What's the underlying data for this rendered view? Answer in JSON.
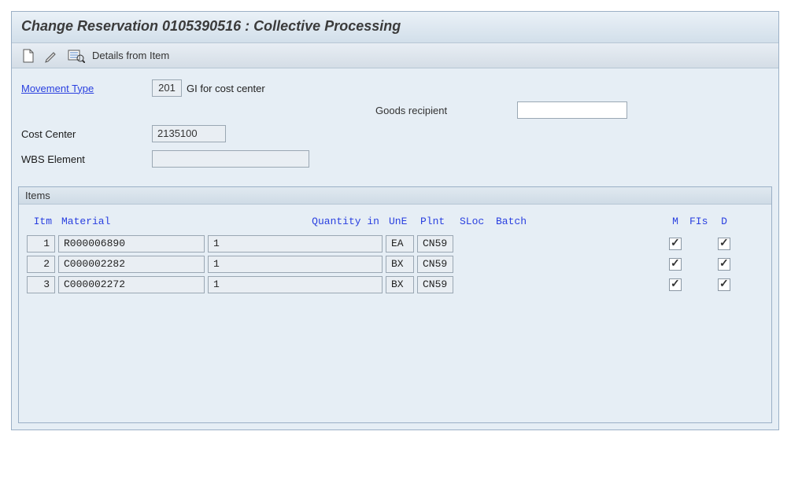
{
  "title": "Change Reservation 0105390516 : Collective Processing",
  "toolbar": {
    "details_label": "Details from Item"
  },
  "header": {
    "movement_type_label": "Movement Type",
    "movement_type_code": "201",
    "movement_type_text": "GI for cost center",
    "goods_recipient_label": "Goods recipient",
    "goods_recipient_value": "",
    "cost_center_label": "Cost Center",
    "cost_center_value": "2135100",
    "wbs_label": "WBS Element",
    "wbs_value": ""
  },
  "items_panel": {
    "title": "Items",
    "columns": {
      "itm": "Itm",
      "material": "Material",
      "quantity": "Quantity in",
      "une": "UnE",
      "plnt": "Plnt",
      "sloc": "SLoc",
      "batch": "Batch",
      "m": "M",
      "fis": "FIs",
      "d": "D"
    },
    "rows": [
      {
        "itm": "1",
        "material": "R000006890",
        "quantity": "1",
        "une": "EA",
        "plnt": "CN59",
        "m": true,
        "fis": true,
        "d": true
      },
      {
        "itm": "2",
        "material": "C000002282",
        "quantity": "1",
        "une": "BX",
        "plnt": "CN59",
        "m": true,
        "fis": true,
        "d": true
      },
      {
        "itm": "3",
        "material": "C000002272",
        "quantity": "1",
        "une": "BX",
        "plnt": "CN59",
        "m": true,
        "fis": true,
        "d": true
      }
    ]
  }
}
